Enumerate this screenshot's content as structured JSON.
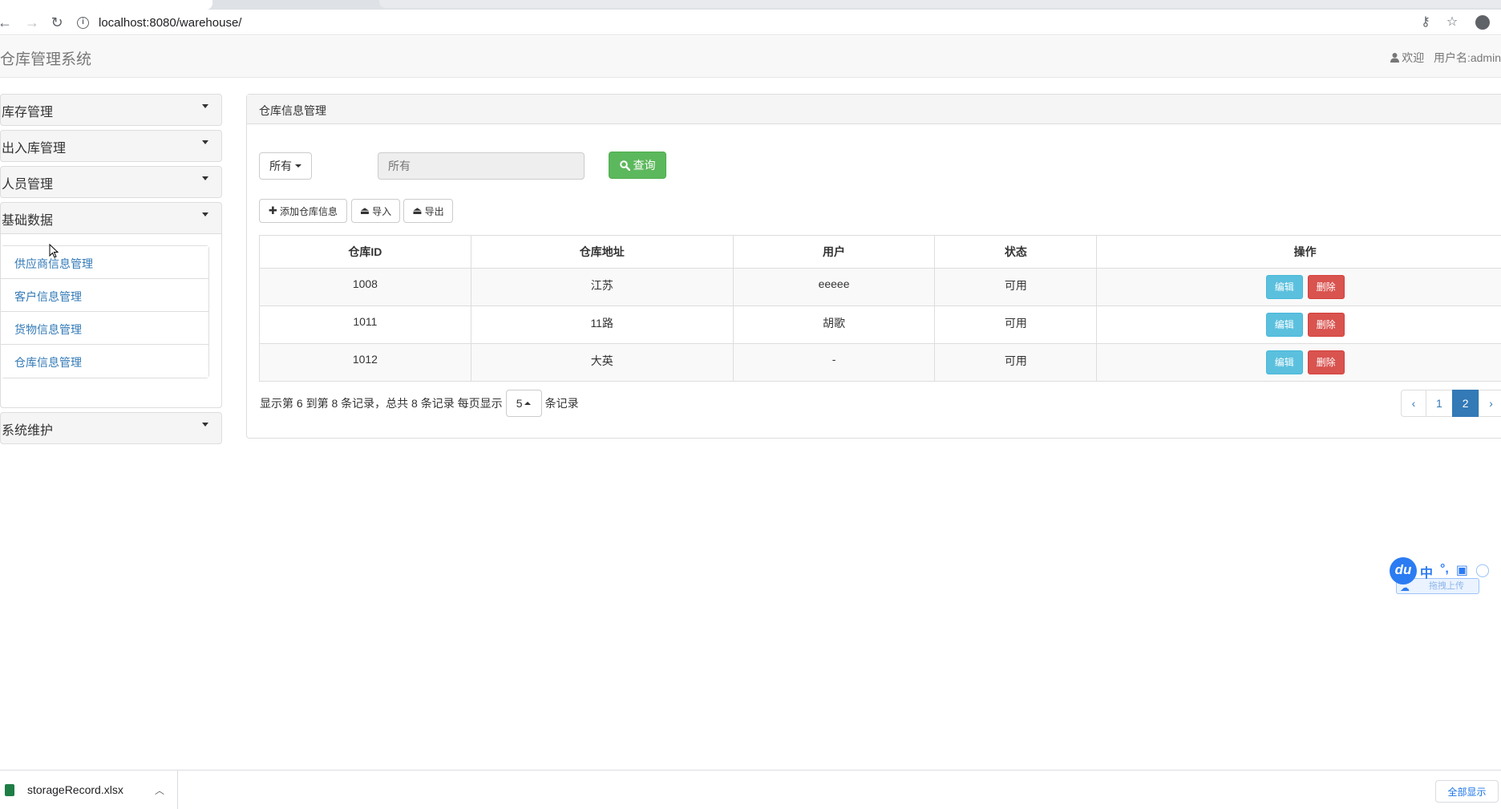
{
  "browser": {
    "url": "localhost:8080/warehouse/"
  },
  "header": {
    "brand": "仓库管理系统",
    "welcome": "欢迎",
    "username": "用户名:admin"
  },
  "sidebar": {
    "groups": [
      {
        "label": "库存管理"
      },
      {
        "label": "出入库管理"
      },
      {
        "label": "人员管理"
      },
      {
        "label": "基础数据",
        "expanded": true,
        "items": [
          "供应商信息管理",
          "客户信息管理",
          "货物信息管理",
          "仓库信息管理"
        ]
      },
      {
        "label": "系统维护"
      }
    ]
  },
  "main": {
    "panel_title": "仓库信息管理",
    "filter_select": "所有",
    "search_placeholder": "所有",
    "query_label": "查询",
    "add_label": "添加仓库信息",
    "import_label": "导入",
    "export_label": "导出",
    "table": {
      "headers": [
        "仓库ID",
        "仓库地址",
        "用户",
        "状态",
        "操作"
      ],
      "rows": [
        {
          "id": "1008",
          "address": "江苏",
          "user": "eeeee",
          "status": "可用"
        },
        {
          "id": "1011",
          "address": "11路",
          "user": "胡歌",
          "status": "可用"
        },
        {
          "id": "1012",
          "address": "大英",
          "user": "-",
          "status": "可用"
        }
      ],
      "edit_label": "编辑",
      "delete_label": "删除"
    },
    "pager": {
      "info": "显示第 6 到第 8 条记录，总共 8 条记录 每页显示",
      "page_size": "5",
      "suffix": "条记录",
      "prev": "‹",
      "pages": [
        "1",
        "2"
      ],
      "current": "2",
      "next": "›"
    }
  },
  "ime": {
    "logo": "du",
    "lang": "中",
    "punct": "°,",
    "upload": "拖拽上传"
  },
  "download_bar": {
    "file_name": "storageRecord.xlsx",
    "show_all": "全部显示"
  },
  "colors": {
    "primary": "#337ab7",
    "success": "#5cb85c",
    "info": "#5bc0de",
    "danger": "#d9534f"
  }
}
